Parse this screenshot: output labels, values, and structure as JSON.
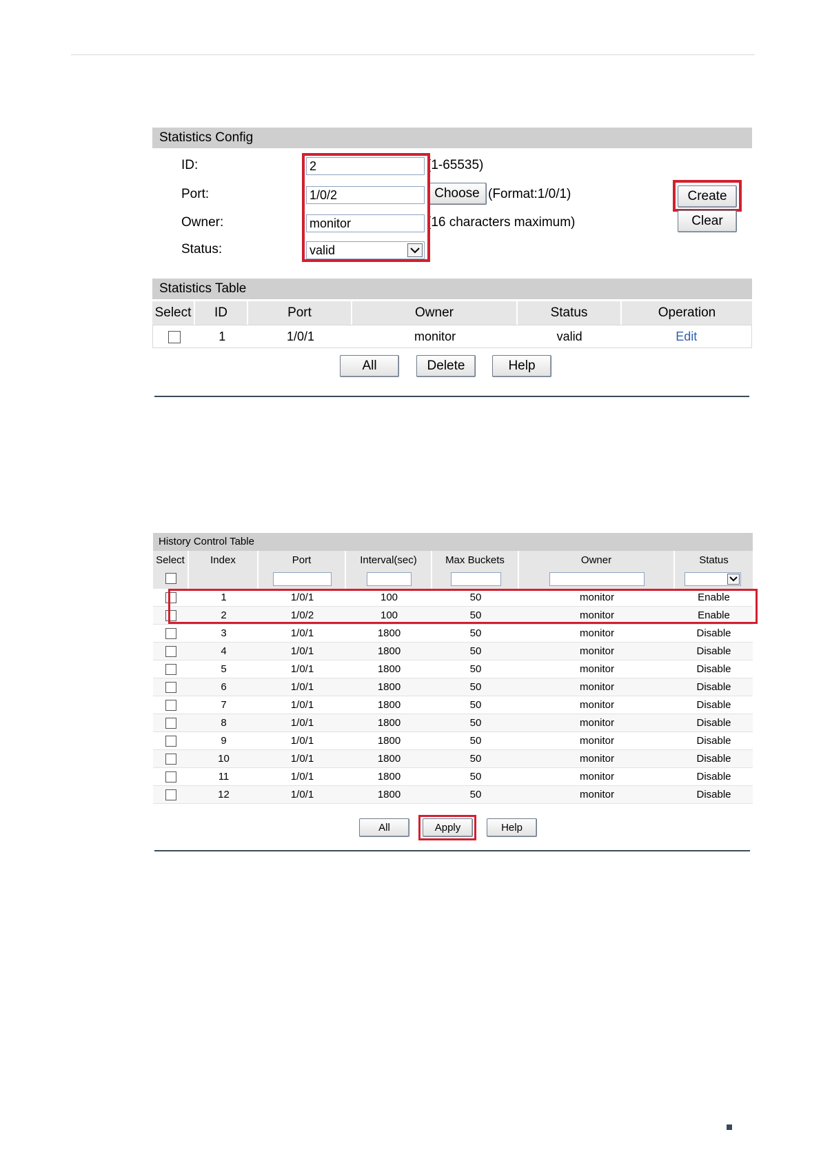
{
  "statistics_config": {
    "title": "Statistics Config",
    "id_label": "ID:",
    "id_value": "2",
    "id_hint": "(1-65535)",
    "port_label": "Port:",
    "port_value": "1/0/2",
    "choose_label": "Choose",
    "port_hint": "(Format:1/0/1)",
    "owner_label": "Owner:",
    "owner_value": "monitor",
    "owner_hint": "(16 characters maximum)",
    "status_label": "Status:",
    "status_value": "valid",
    "create_label": "Create",
    "clear_label": "Clear"
  },
  "statistics_table": {
    "title": "Statistics Table",
    "columns": [
      "Select",
      "ID",
      "Port",
      "Owner",
      "Status",
      "Operation"
    ],
    "row": {
      "id": "1",
      "port": "1/0/1",
      "owner": "monitor",
      "status": "valid",
      "operation": "Edit"
    },
    "buttons": {
      "all": "All",
      "delete": "Delete",
      "help": "Help"
    }
  },
  "history_table": {
    "title": "History Control Table",
    "columns": [
      "Select",
      "Index",
      "Port",
      "Interval(sec)",
      "Max Buckets",
      "Owner",
      "Status"
    ],
    "rows": [
      [
        "1",
        "1/0/1",
        "100",
        "50",
        "monitor",
        "Enable"
      ],
      [
        "2",
        "1/0/2",
        "100",
        "50",
        "monitor",
        "Enable"
      ],
      [
        "3",
        "1/0/1",
        "1800",
        "50",
        "monitor",
        "Disable"
      ],
      [
        "4",
        "1/0/1",
        "1800",
        "50",
        "monitor",
        "Disable"
      ],
      [
        "5",
        "1/0/1",
        "1800",
        "50",
        "monitor",
        "Disable"
      ],
      [
        "6",
        "1/0/1",
        "1800",
        "50",
        "monitor",
        "Disable"
      ],
      [
        "7",
        "1/0/1",
        "1800",
        "50",
        "monitor",
        "Disable"
      ],
      [
        "8",
        "1/0/1",
        "1800",
        "50",
        "monitor",
        "Disable"
      ],
      [
        "9",
        "1/0/1",
        "1800",
        "50",
        "monitor",
        "Disable"
      ],
      [
        "10",
        "1/0/1",
        "1800",
        "50",
        "monitor",
        "Disable"
      ],
      [
        "11",
        "1/0/1",
        "1800",
        "50",
        "monitor",
        "Disable"
      ],
      [
        "12",
        "1/0/1",
        "1800",
        "50",
        "monitor",
        "Disable"
      ]
    ],
    "buttons": {
      "all": "All",
      "apply": "Apply",
      "help": "Help"
    }
  },
  "colors": {
    "highlight": "#d2202f",
    "header_bg": "#cfcfcf",
    "link": "#2f5fb0"
  },
  "icons": {
    "dropdown": "chevron-down-icon",
    "page_marker": "square-icon"
  }
}
